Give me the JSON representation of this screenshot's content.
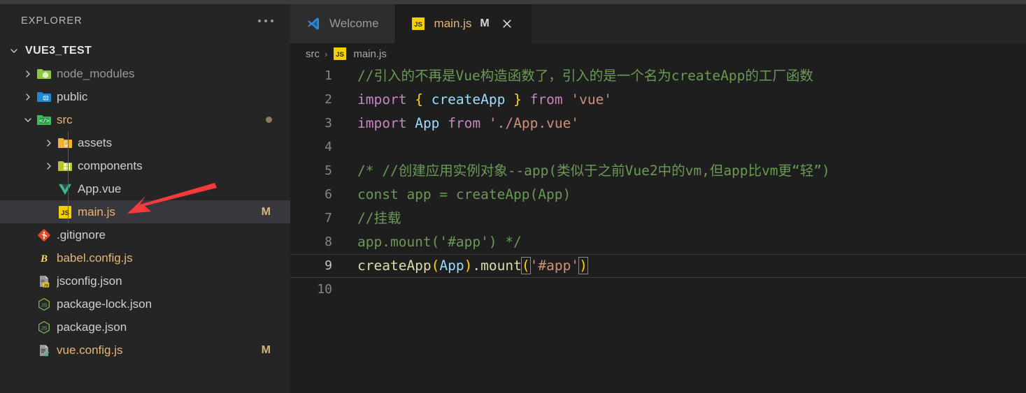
{
  "sidebar": {
    "header_title": "EXPLORER",
    "more_actions_icon": "ellipsis-icon",
    "tree": [
      {
        "label": "VUE3_TEST",
        "type": "root",
        "indent": 0,
        "expanded": true,
        "icon": "none",
        "badge": "",
        "dot": false,
        "selected": false
      },
      {
        "label": "node_modules",
        "type": "folder",
        "indent": 1,
        "expanded": false,
        "icon": "folder-node-icon",
        "badge": "",
        "dot": false,
        "selected": false
      },
      {
        "label": "public",
        "type": "folder",
        "indent": 1,
        "expanded": false,
        "icon": "folder-public-icon",
        "badge": "",
        "dot": false,
        "selected": false
      },
      {
        "label": "src",
        "type": "folder",
        "indent": 1,
        "expanded": true,
        "icon": "folder-src-icon",
        "badge": "",
        "dot": true,
        "selected": false
      },
      {
        "label": "assets",
        "type": "folder",
        "indent": 2,
        "expanded": false,
        "icon": "folder-assets-icon",
        "badge": "",
        "dot": false,
        "selected": false
      },
      {
        "label": "components",
        "type": "folder",
        "indent": 2,
        "expanded": false,
        "icon": "folder-components-icon",
        "badge": "",
        "dot": false,
        "selected": false
      },
      {
        "label": "App.vue",
        "type": "file",
        "indent": 2,
        "expanded": false,
        "icon": "vue-file-icon",
        "badge": "",
        "dot": false,
        "selected": false
      },
      {
        "label": "main.js",
        "type": "file",
        "indent": 2,
        "expanded": false,
        "icon": "js-file-icon",
        "badge": "M",
        "dot": false,
        "selected": true
      },
      {
        "label": ".gitignore",
        "type": "file",
        "indent": 1,
        "expanded": false,
        "icon": "git-file-icon",
        "badge": "",
        "dot": false,
        "selected": false
      },
      {
        "label": "babel.config.js",
        "type": "file",
        "indent": 1,
        "expanded": false,
        "icon": "babel-file-icon",
        "badge": "",
        "dot": false,
        "selected": false
      },
      {
        "label": "jsconfig.json",
        "type": "file",
        "indent": 1,
        "expanded": false,
        "icon": "jsconfig-file-icon",
        "badge": "",
        "dot": false,
        "selected": false
      },
      {
        "label": "package-lock.json",
        "type": "file",
        "indent": 1,
        "expanded": false,
        "icon": "npm-file-icon",
        "badge": "",
        "dot": false,
        "selected": false
      },
      {
        "label": "package.json",
        "type": "file",
        "indent": 1,
        "expanded": false,
        "icon": "npm-file-icon",
        "badge": "",
        "dot": false,
        "selected": false
      },
      {
        "label": "vue.config.js",
        "type": "file",
        "indent": 1,
        "expanded": false,
        "icon": "vueconfig-file-icon",
        "badge": "M",
        "dot": false,
        "selected": false
      }
    ]
  },
  "tabs": [
    {
      "label": "Welcome",
      "icon": "vscode-logo-icon",
      "modified": "",
      "closable": false,
      "active": false
    },
    {
      "label": "main.js",
      "icon": "js-file-icon",
      "modified": "M",
      "closable": true,
      "active": true
    }
  ],
  "breadcrumb": {
    "items": [
      {
        "label": "src",
        "icon": "none"
      },
      {
        "label": "main.js",
        "icon": "js-file-icon"
      }
    ],
    "separator": "›"
  },
  "editor": {
    "active_line": 9,
    "lines": [
      {
        "n": "1",
        "dirty": true,
        "active": false
      },
      {
        "n": "2",
        "dirty": false,
        "active": false
      },
      {
        "n": "3",
        "dirty": false,
        "active": false
      },
      {
        "n": "4",
        "dirty": false,
        "active": false
      },
      {
        "n": "5",
        "dirty": true,
        "active": false
      },
      {
        "n": "6",
        "dirty": true,
        "active": false
      },
      {
        "n": "7",
        "dirty": true,
        "active": false
      },
      {
        "n": "8",
        "dirty": true,
        "active": false
      },
      {
        "n": "9",
        "dirty": false,
        "active": true
      },
      {
        "n": "10",
        "dirty": false,
        "active": false
      }
    ],
    "text": {
      "l1": "//引入的不再是Vue构造函数了，引入的是一个名为createApp的工厂函数",
      "l2_kw_import": "import",
      "l2_brace_open": "{",
      "l2_ident": "createApp",
      "l2_brace_close": "}",
      "l2_kw_from": "from",
      "l2_str": "'vue'",
      "l3_kw_import": "import",
      "l3_ident": "App",
      "l3_kw_from": "from",
      "l3_str": "'./App.vue'",
      "l4": "",
      "l5": "/* //创建应用实例对象--app(类似于之前Vue2中的vm,但app比vm更“轻”)",
      "l6": "const app = createApp(App)",
      "l7": "//挂载",
      "l8": "app.mount('#app') */",
      "l9_fn": "createApp",
      "l9_paren_open": "(",
      "l9_arg": "App",
      "l9_paren_close": ")",
      "l9_dot": ".",
      "l9_method": "mount",
      "l9_paren2_open": "(",
      "l9_str": "'#app'",
      "l9_paren2_close": ")",
      "l10": ""
    }
  },
  "annotation": {
    "arrow_color": "#f43a3a",
    "arrow_name": "red-pointer-arrow"
  },
  "colors": {
    "sidebar_bg": "#252526",
    "editor_bg": "#1e1e1e",
    "selected_row": "#37373d",
    "tab_inactive": "#2d2d2d",
    "modified_badge": "#d4b87a",
    "comment_green": "#6a9955",
    "keyword_purple": "#c586c0",
    "string_orange": "#ce9178",
    "function_yellow": "#dcdcaa",
    "variable_blue": "#9cdcfe",
    "bracket_yellow": "#ffd700",
    "gutter_dirty_green": "#587c0c"
  }
}
